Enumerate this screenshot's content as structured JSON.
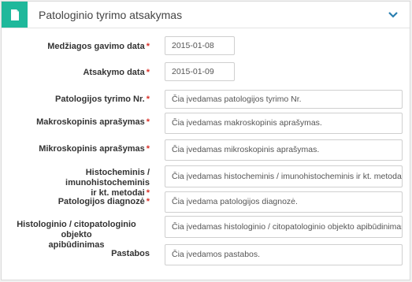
{
  "header": {
    "title": "Patologinio tyrimo atsakymas",
    "icon": "document-icon",
    "collapse_icon": "chevron-down-icon",
    "accent_color": "#1fb89b"
  },
  "fields": [
    {
      "label": "Medžiagos gavimo data",
      "required": "*",
      "value": "2015-01-08"
    },
    {
      "label": "Atsakymo data",
      "required": "*",
      "value": "2015-01-09"
    },
    {
      "label": "Patologijos tyrimo Nr.",
      "required": "*",
      "placeholder": "Čia įvedamas patologijos tyrimo Nr."
    },
    {
      "label": "Makroskopinis aprašymas",
      "required": "*",
      "placeholder": "Čia įvedamas makroskopinis aprašymas."
    },
    {
      "label": "Mikroskopinis aprašymas",
      "required": "*",
      "placeholder": "Čia įvedamas mikroskopinis aprašymas."
    },
    {
      "label_line1": "Histocheminis / imunohistocheminis",
      "label_line2": "ir kt. metodai",
      "required": "*",
      "placeholder": "Čia įvedamas histocheminis / imunohistocheminis ir kt. metodai."
    },
    {
      "label": "Patologijos diagnozė",
      "required": "*",
      "placeholder": "Čia įvedama patologijos diagnozė."
    },
    {
      "label_line1": "Histologinio / citopatologinio objekto",
      "label_line2": "apibūdinimas",
      "placeholder": "Čia įvedamas histologinio / citopatologinio objekto apibūdinimas."
    },
    {
      "label": "Pastabos",
      "placeholder": "Čia įvedamos pastabos."
    }
  ]
}
